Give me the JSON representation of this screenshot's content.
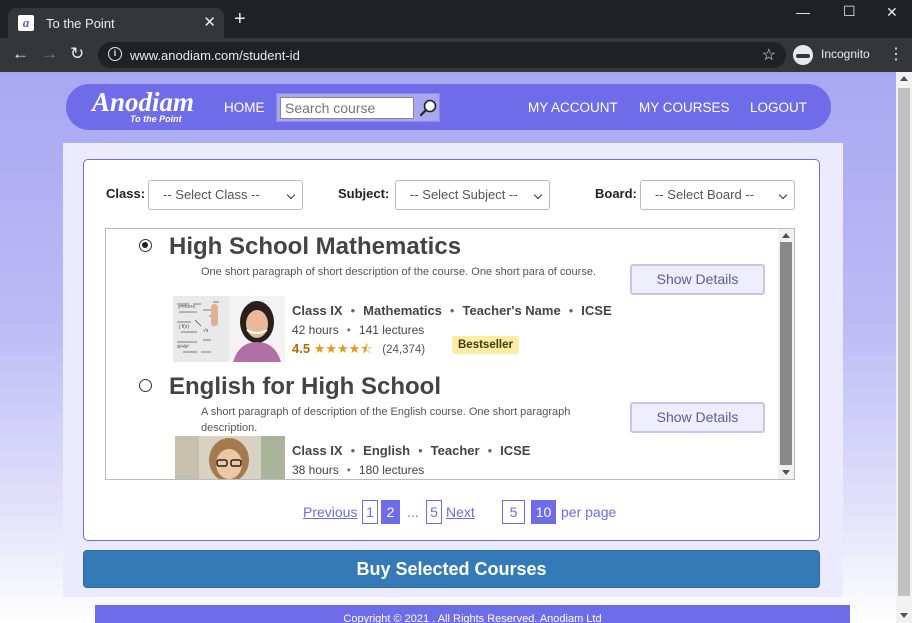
{
  "browser": {
    "tab_title": "To the Point",
    "favicon": "a",
    "url": "www.anodiam.com/student-id",
    "incognito_label": "Incognito"
  },
  "site": {
    "logo_main": "Anodiam",
    "logo_tagline": "To the Point",
    "nav": {
      "home": "HOME",
      "my_account": "MY ACCOUNT",
      "my_courses": "MY COURSES",
      "logout": "LOGOUT"
    },
    "search": {
      "placeholder": "Search course"
    }
  },
  "filters": {
    "class_label": "Class:",
    "class_value": "-- Select Class --",
    "subject_label": "Subject:",
    "subject_value": "-- Select Subject --",
    "board_label": "Board:",
    "board_value": "-- Select Board --"
  },
  "courses": [
    {
      "title": "High School Mathematics",
      "selected": true,
      "description": "One short paragraph of short description of the course. One short para of course.",
      "class": "Class IX",
      "subject": "Mathematics",
      "teacher": "Teacher's Name",
      "board": "ICSE",
      "hours": "42 hours",
      "lectures": "141 lectures",
      "rating": "4.5",
      "stars": "★★★★⯪",
      "rating_count": "(24,374)",
      "badge": "Bestseller",
      "button": "Show Details"
    },
    {
      "title": "English for High School",
      "selected": false,
      "description": "A short paragraph of description of the English course. One short paragraph description.",
      "class": "Class IX",
      "subject": "English",
      "teacher": "Teacher",
      "board": "ICSE",
      "hours": "38 hours",
      "lectures": "180 lectures",
      "button": "Show Details"
    }
  ],
  "pagination": {
    "previous": "Previous",
    "pages": [
      "1",
      "2",
      "5"
    ],
    "current_page": "2",
    "ellipsis": "...",
    "next": "Next",
    "per_page_options": [
      "5",
      "10"
    ],
    "per_page_selected": "10",
    "per_page_label": "per page"
  },
  "buy_button": "Buy Selected Courses",
  "footer": "Copyright © 2021 . All Rights Reserved. Anodiam Ltd",
  "colors": {
    "brand": "#6e6ce8",
    "buy_button": "#337ab7",
    "badge": "#fceca4",
    "stars": "#e59819"
  }
}
